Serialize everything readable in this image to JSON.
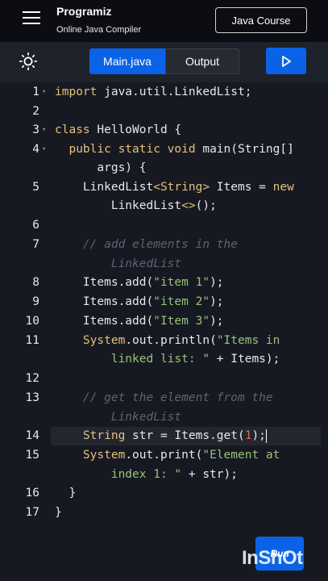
{
  "header": {
    "brand_name": "Programiz",
    "brand_sub": "Online Java Compiler",
    "course_label": "Java Course"
  },
  "toolbar": {
    "tab_main": "Main.java",
    "tab_output": "Output"
  },
  "editor": {
    "lines": [
      {
        "n": "1",
        "fold": true,
        "tokens": [
          [
            "kw",
            "import"
          ],
          [
            "tx",
            " java.util.LinkedList;"
          ]
        ]
      },
      {
        "n": "2",
        "tokens": []
      },
      {
        "n": "3",
        "fold": true,
        "tokens": [
          [
            "kw",
            "class"
          ],
          [
            "tx",
            " HelloWorld {"
          ]
        ]
      },
      {
        "n": "4",
        "fold": true,
        "tokens": [
          [
            "tx",
            "  "
          ],
          [
            "kw",
            "public static void"
          ],
          [
            "tx",
            " main(String[]"
          ]
        ]
      },
      {
        "n": "",
        "tokens": [
          [
            "tx",
            "      args) {"
          ]
        ]
      },
      {
        "n": "5",
        "tokens": [
          [
            "tx",
            "    LinkedList"
          ],
          [
            "ty",
            "<String>"
          ],
          [
            "tx",
            " Items = "
          ],
          [
            "kw",
            "new"
          ]
        ]
      },
      {
        "n": "",
        "tokens": [
          [
            "tx",
            "        LinkedList"
          ],
          [
            "ty",
            "<>"
          ],
          [
            "tx",
            "();"
          ]
        ]
      },
      {
        "n": "6",
        "tokens": []
      },
      {
        "n": "7",
        "tokens": [
          [
            "tx",
            "    "
          ],
          [
            "cm",
            "// add elements in the"
          ]
        ]
      },
      {
        "n": "",
        "tokens": [
          [
            "tx",
            "        "
          ],
          [
            "cm",
            "LinkedList"
          ]
        ]
      },
      {
        "n": "8",
        "tokens": [
          [
            "tx",
            "    Items.add("
          ],
          [
            "str",
            "\"item 1\""
          ],
          [
            "tx",
            ");"
          ]
        ]
      },
      {
        "n": "9",
        "tokens": [
          [
            "tx",
            "    Items.add("
          ],
          [
            "str",
            "\"item 2\""
          ],
          [
            "tx",
            ");"
          ]
        ]
      },
      {
        "n": "10",
        "tokens": [
          [
            "tx",
            "    Items.add("
          ],
          [
            "str",
            "\"Item 3\""
          ],
          [
            "tx",
            ");"
          ]
        ]
      },
      {
        "n": "11",
        "tokens": [
          [
            "tx",
            "    "
          ],
          [
            "ty",
            "System"
          ],
          [
            "tx",
            ".out.println("
          ],
          [
            "str",
            "\"Items in"
          ]
        ]
      },
      {
        "n": "",
        "tokens": [
          [
            "str",
            "        linked list: \""
          ],
          [
            "tx",
            " + Items);"
          ]
        ]
      },
      {
        "n": "12",
        "tokens": []
      },
      {
        "n": "13",
        "tokens": [
          [
            "tx",
            "    "
          ],
          [
            "cm",
            "// get the element from the"
          ]
        ]
      },
      {
        "n": "",
        "tokens": [
          [
            "tx",
            "        "
          ],
          [
            "cm",
            "LinkedList"
          ]
        ]
      },
      {
        "n": "14",
        "active": true,
        "tokens": [
          [
            "tx",
            "    "
          ],
          [
            "ty",
            "String"
          ],
          [
            "tx",
            " str = Items.get("
          ],
          [
            "nm",
            "1"
          ],
          [
            "tx",
            ");"
          ]
        ]
      },
      {
        "n": "15",
        "tokens": [
          [
            "tx",
            "    "
          ],
          [
            "ty",
            "System"
          ],
          [
            "tx",
            ".out.print("
          ],
          [
            "str",
            "\"Element at"
          ]
        ]
      },
      {
        "n": "",
        "tokens": [
          [
            "str",
            "        index 1: \""
          ],
          [
            "tx",
            " + str);"
          ]
        ]
      },
      {
        "n": "16",
        "tokens": [
          [
            "tx",
            "  }"
          ]
        ]
      },
      {
        "n": "17",
        "tokens": [
          [
            "tx",
            "}"
          ]
        ]
      }
    ]
  },
  "run_bottom_label": "Run",
  "watermark": "InShOt"
}
